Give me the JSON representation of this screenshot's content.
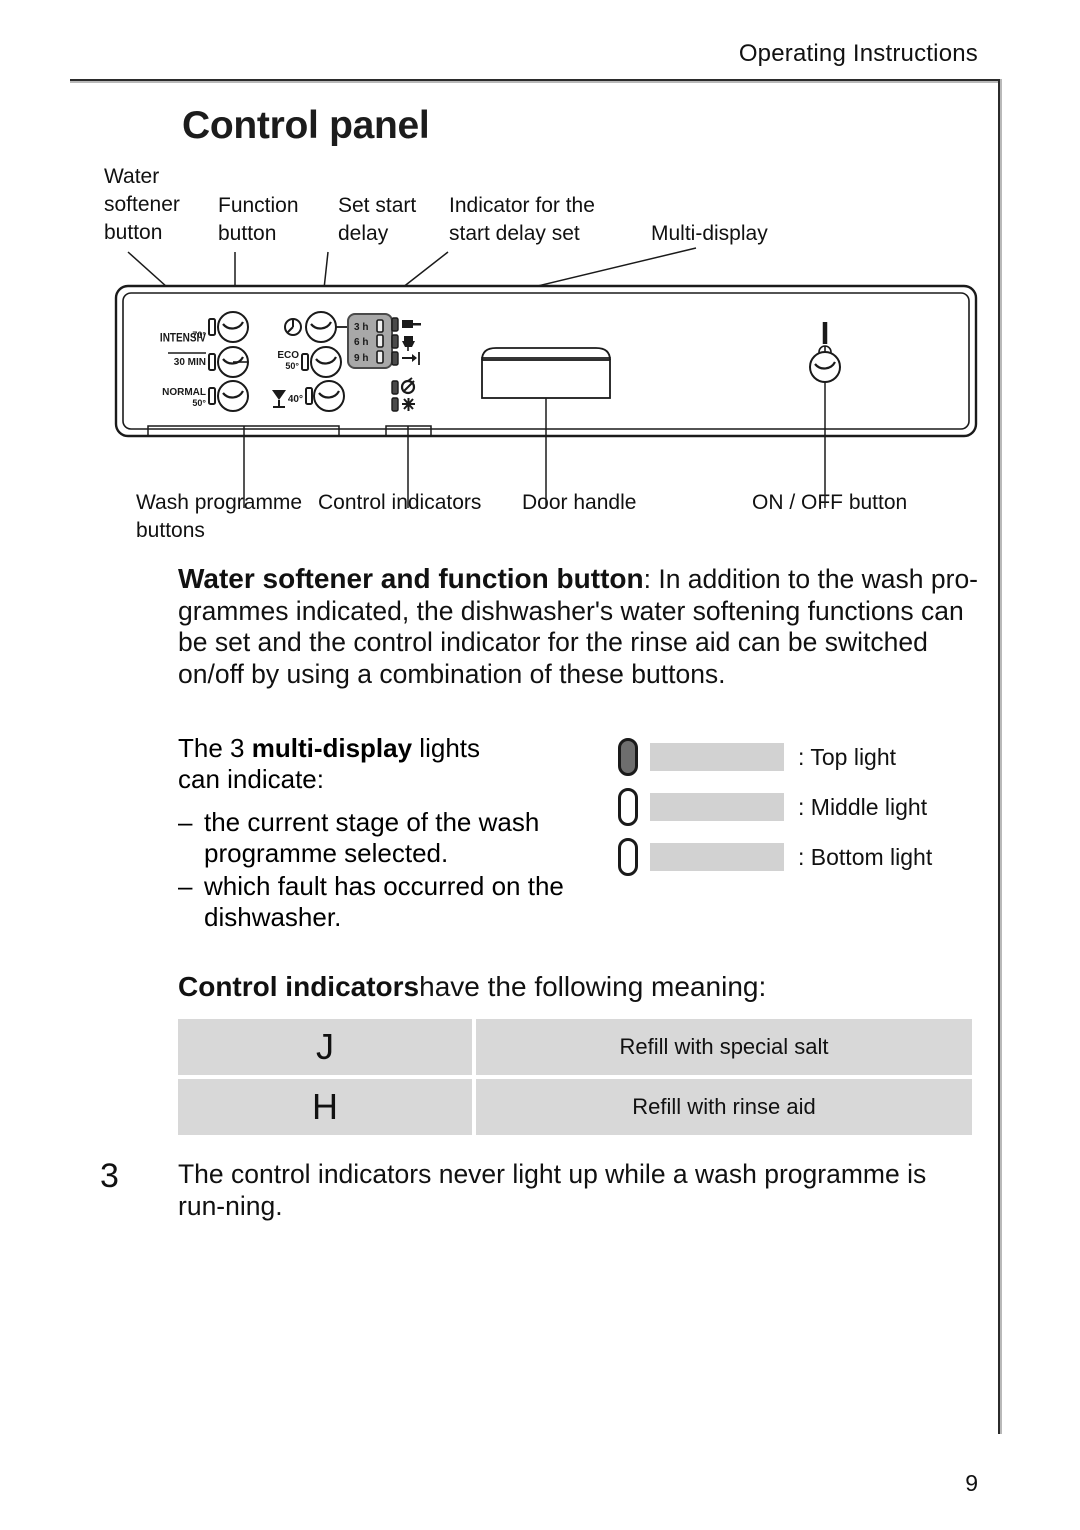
{
  "header": {
    "title": "Operating Instructions",
    "page_number": "9"
  },
  "section": {
    "heading": "Control panel"
  },
  "callouts": {
    "top": [
      {
        "id": "water-softener-button",
        "text": "Water\nsoftener\nbutton"
      },
      {
        "id": "function-button",
        "text": "Function\nbutton"
      },
      {
        "id": "set-start-delay",
        "text": "Set start\ndelay"
      },
      {
        "id": "indicator-start-delay",
        "text": "Indicator for the\nstart delay set"
      },
      {
        "id": "multi-display",
        "text": "Multi-display"
      }
    ],
    "bottom": [
      {
        "id": "wash-programme-buttons",
        "text": "Wash programme\nbuttons"
      },
      {
        "id": "control-indicators",
        "text": "Control indicators"
      },
      {
        "id": "door-handle",
        "text": "Door handle"
      },
      {
        "id": "on-off-button",
        "text": "ON / OFF button"
      }
    ]
  },
  "panel": {
    "programme_buttons": [
      {
        "line1": "INTENSIV",
        "line2": "70°"
      },
      {
        "line1": "30 MIN",
        "line2": ""
      },
      {
        "line1": "NORMAL",
        "line2": "50°"
      }
    ],
    "function_buttons": [
      {
        "line1": "",
        "line2": "",
        "icon": "clock-icon"
      },
      {
        "line1": "ECO",
        "line2": "50°"
      },
      {
        "line1": "40°",
        "line2": "",
        "icon": "glass-icon"
      }
    ],
    "delay_display": [
      "3 h",
      "6 h",
      "9 h"
    ],
    "indicator_icons": [
      "wash-stage-icon",
      "dry-stage-icon",
      "end-stage-icon",
      "salt-refill-icon",
      "rinse-aid-icon"
    ],
    "power_button": "power-icon"
  },
  "body": {
    "softener_bold": "Water softener and function button",
    "softener_rest": ": In addition to the wash pro-grammes indicated, the dishwasher's water softening functions can be set and the control indicator for the rinse aid can be switched on/off by using a combination of these buttons.",
    "multi_lead_1": "The 3 ",
    "multi_lead_bold": "multi-display",
    "multi_lead_2": " lights",
    "multi_lead_3": "can indicate:",
    "multi_items": [
      "the current stage of the wash programme selected.",
      "which fault has occurred on the dishwasher."
    ],
    "dash": "–"
  },
  "light_legend": [
    {
      "state": "on",
      "label": ": Top light"
    },
    {
      "state": "off",
      "label": ": Middle light"
    },
    {
      "state": "off",
      "label": ": Bottom light"
    }
  ],
  "indicators": {
    "heading_bold": "Control indicators",
    "heading_rest": "have the following meaning:",
    "rows": [
      {
        "symbol": "J",
        "meaning": "Refill with special salt"
      },
      {
        "symbol": "H",
        "meaning": "Refill with rinse aid"
      }
    ]
  },
  "note": {
    "marker": "3",
    "text": "The control indicators never light up while a wash programme is run-ning."
  },
  "colors": {
    "rule": "#2b2b2b",
    "table_cell": "#d8d8d8",
    "grey_bar": "#d2d2d2",
    "light_on": "#6e6e6e"
  }
}
